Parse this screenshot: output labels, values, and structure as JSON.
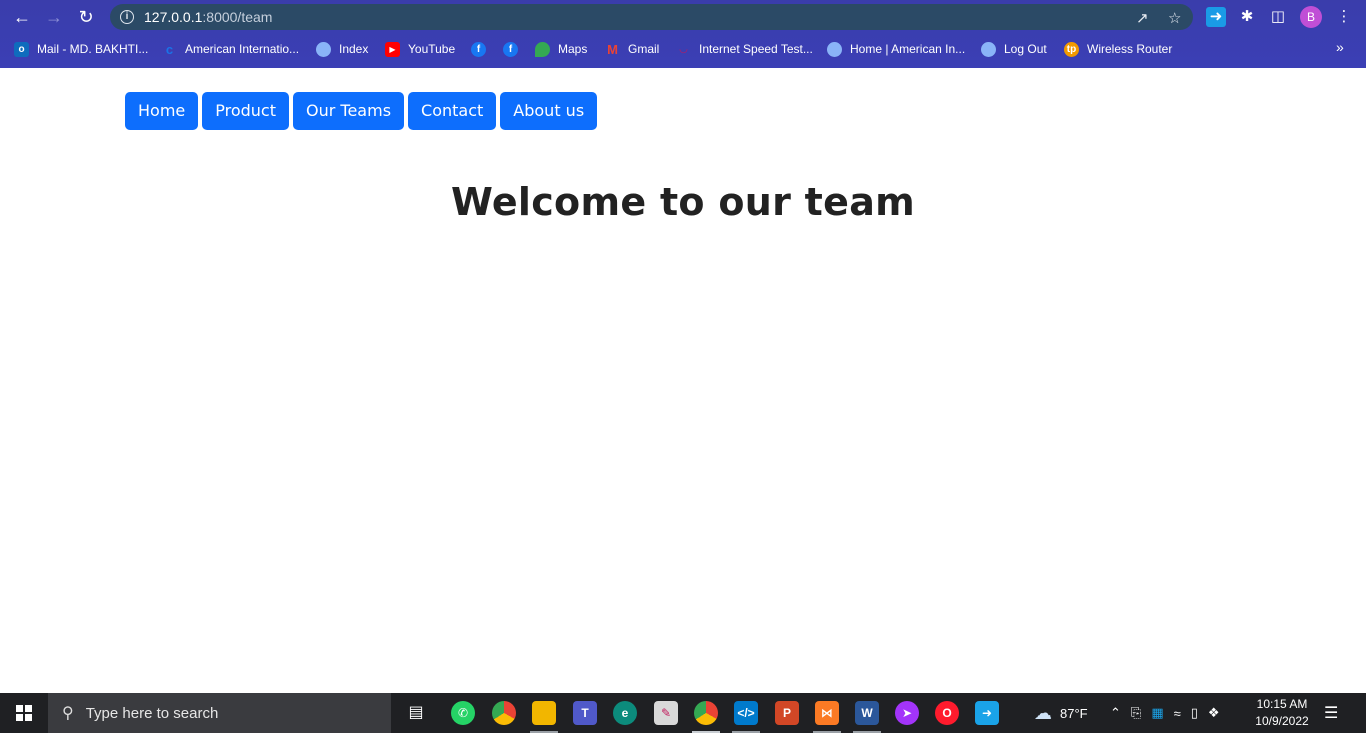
{
  "browser": {
    "url_host": "127.0.0.1",
    "url_path": ":8000/team",
    "profile_initial": "B",
    "bookmarks": [
      {
        "label": "Mail - MD. BAKHTI...",
        "icon": "outlook-icon",
        "color": "#0f6cbd"
      },
      {
        "label": "American Internatio...",
        "icon": "c-icon",
        "color": "#1a73e8"
      },
      {
        "label": "Index",
        "icon": "shield-icon",
        "color": "#8ab4f8"
      },
      {
        "label": "YouTube",
        "icon": "youtube-icon",
        "color": "#ff0000"
      },
      {
        "label": "",
        "icon": "facebook-icon",
        "color": "#1877f2"
      },
      {
        "label": "",
        "icon": "facebook-icon",
        "color": "#1877f2"
      },
      {
        "label": "Maps",
        "icon": "maps-icon",
        "color": "#34a853"
      },
      {
        "label": "Gmail",
        "icon": "gmail-icon",
        "color": "#ea4335"
      },
      {
        "label": "Internet Speed Test...",
        "icon": "speedtest-icon",
        "color": "#c2185b"
      },
      {
        "label": "Home | American In...",
        "icon": "shield-icon",
        "color": "#8ab4f8"
      },
      {
        "label": "Log Out",
        "icon": "shield-icon",
        "color": "#8ab4f8"
      },
      {
        "label": "Wireless Router",
        "icon": "router-icon",
        "color": "#f29900"
      }
    ]
  },
  "nav": {
    "items": [
      "Home",
      "Product",
      "Our Teams",
      "Contact",
      "About us"
    ]
  },
  "main": {
    "title": "Welcome to our team"
  },
  "taskbar": {
    "search_placeholder": "Type here to search",
    "weather": "87°F",
    "time": "10:15 AM",
    "date": "10/9/2022",
    "apps": [
      {
        "name": "task-view-icon",
        "color": "transparent"
      },
      {
        "name": "whatsapp-icon",
        "color": "#25d366"
      },
      {
        "name": "chrome-icon",
        "color": "#4285f4"
      },
      {
        "name": "file-explorer-icon",
        "color": "#f2b600"
      },
      {
        "name": "teams-icon",
        "color": "#5059c9"
      },
      {
        "name": "edge-icon",
        "color": "#0c8b7c"
      },
      {
        "name": "paint-icon",
        "color": "#e8e8e8"
      },
      {
        "name": "chrome-profile-icon",
        "color": "#4285f4"
      },
      {
        "name": "vscode-icon",
        "color": "#007acc"
      },
      {
        "name": "powerpoint-icon",
        "color": "#d24726"
      },
      {
        "name": "xampp-icon",
        "color": "#fb7a24"
      },
      {
        "name": "word-icon",
        "color": "#2b579a"
      },
      {
        "name": "messenger-icon",
        "color": "#a334fa"
      },
      {
        "name": "opera-icon",
        "color": "#ff1b2d"
      },
      {
        "name": "remote-icon",
        "color": "#1aa3e8"
      }
    ]
  }
}
